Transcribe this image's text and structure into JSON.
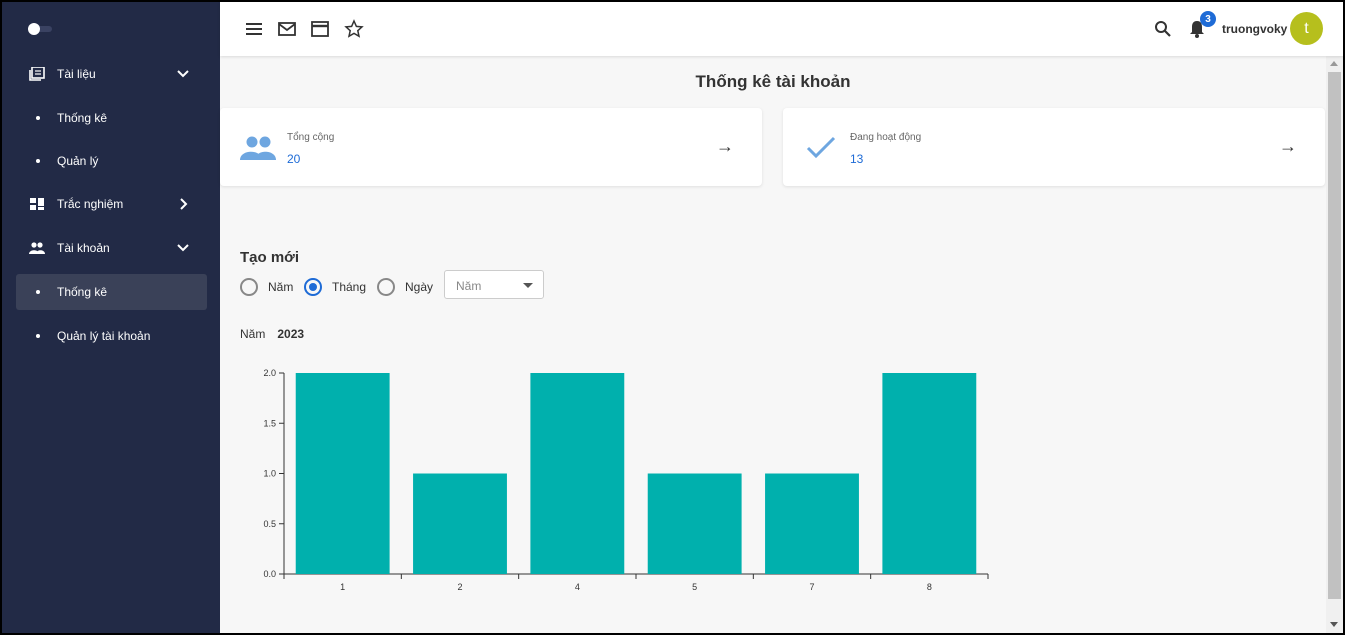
{
  "sidebar": {
    "items": [
      {
        "label": "Tài liệu",
        "icon": "library-books-icon"
      },
      {
        "label": "Thống kê"
      },
      {
        "label": "Quản lý"
      },
      {
        "label": "Trắc nghiệm",
        "icon": "dashboard-icon"
      },
      {
        "label": "Tài khoản",
        "icon": "people-icon"
      },
      {
        "label": "Thống kê"
      },
      {
        "label": "Quản lý tài khoản"
      }
    ]
  },
  "topbar": {
    "icons": [
      "menu-icon",
      "mail-icon",
      "window-icon",
      "star-icon",
      "search-icon",
      "bell-icon"
    ],
    "notification_count": "3",
    "username": "truongvoky",
    "avatar_letter": "t"
  },
  "main": {
    "title": "Thống kê tài khoản",
    "cards": [
      {
        "label": "Tổng cộng",
        "value": "20",
        "arrow": "→",
        "icon": "people-icon"
      },
      {
        "label": "Đang hoạt động",
        "value": "13",
        "arrow": "→",
        "icon": "check-icon"
      }
    ],
    "section_title": "Tạo mới",
    "radios": [
      {
        "label": "Năm",
        "checked": false
      },
      {
        "label": "Tháng",
        "checked": true
      },
      {
        "label": "Ngày",
        "checked": false
      }
    ],
    "select_value": "Năm",
    "year_label": "Năm",
    "year_value": "2023"
  },
  "colors": {
    "sidebar_bg": "#222a46",
    "accent": "#1e6bd6",
    "bar": "#00b0ad",
    "avatar": "#b6bf1d"
  },
  "chart_data": {
    "type": "bar",
    "categories": [
      "1",
      "2",
      "4",
      "5",
      "7",
      "8"
    ],
    "values": [
      2,
      1,
      2,
      1,
      1,
      2
    ],
    "ylim": [
      0,
      2
    ],
    "yticks": [
      "0.0",
      "0.5",
      "1.0",
      "1.5",
      "2.0"
    ],
    "xlabel": "",
    "ylabel": ""
  }
}
